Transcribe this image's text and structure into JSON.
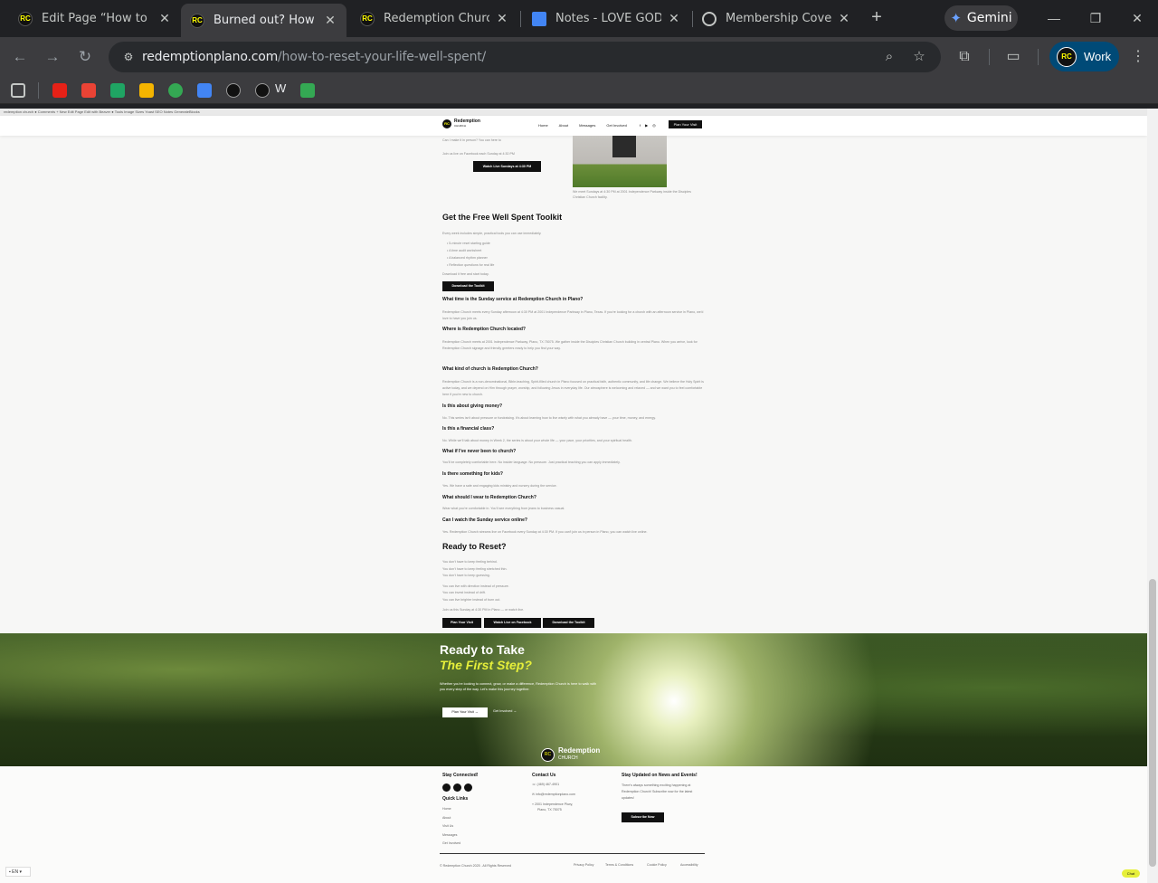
{
  "browser": {
    "tabs": [
      {
        "title": "Edit Page “How to Res"
      },
      {
        "title": "Burned out? How to R"
      },
      {
        "title": "Redemption Church | I"
      },
      {
        "title": "Notes - LOVE GOD Sta"
      },
      {
        "title": "Membership Covenan"
      }
    ],
    "gemini_label": "Gemini",
    "url_host": "redemptionplano.com",
    "url_path": "/how-to-reset-your-life-well-spent/",
    "profile_label": "Work",
    "bookmark_w": "W"
  },
  "site": {
    "admin_bar": "redemption church   ● Comments   + New   Edit Page   Edit with Beaver   ● Tools   Image Sizes   Yoast SEO   Notes   GenerateBlocks",
    "header": {
      "logo_name": "Redemption",
      "logo_sub": "CHURCH",
      "menu": [
        "Home",
        "About",
        "Messages",
        "Get Involved"
      ],
      "plan_button": "Plan Your Visit"
    },
    "top": {
      "line1": "Can I make it in person? You can here to",
      "line2": "Join us live on Facebook each Sunday at 4:30 PM",
      "watch_button": "Watch Live Sundays at 4:30 PM",
      "photo_caption": "We meet Sundays at 4:30 PM at 2001 Independence Parkway inside the Disciples Christian Church facility."
    },
    "toolkit": {
      "title": "Get the Free Well Spent Toolkit",
      "intro": "Every week includes simple, practical tools you can use immediately.",
      "items": [
        "5-minute reset starting guide",
        "A time audit worksheet",
        "A balanced rhythm planner",
        "Reflection questions for real life"
      ],
      "outro": "Download it free and start today.",
      "button": "Download the Toolkit"
    },
    "faq": [
      {
        "q": "What time is the Sunday service at Redemption Church in Plano?",
        "a": "Redemption Church meets every Sunday afternoon at 4:30 PM at 2001 Independence Parkway in Plano, Texas. If you're looking for a church with an afternoon service in Plano, we'd love to have you join us."
      },
      {
        "q": "Where is Redemption Church located?",
        "a": "Redemption Church meets at 2001 Independence Parkway, Plano, TX 75075. We gather inside the Disciples Christian Church building in central Plano. When you arrive, look for Redemption Church signage and friendly greeters ready to help you find your way."
      },
      {
        "q": "What kind of church is Redemption Church?",
        "a": "Redemption Church is a non-denominational, Bible-teaching, Spirit-filled church in Plano focused on practical faith, authentic community, and life change. We believe the Holy Spirit is active today, and we depend on Him through prayer, worship, and following Jesus in everyday life. Our atmosphere is welcoming and relaxed — and we want you to feel comfortable here if you're new to church."
      },
      {
        "q": "Is this about giving money?",
        "a": "No. This series isn't about pressure or fundraising. It's about learning how to live wisely with what you already have — your time, money, and energy."
      },
      {
        "q": "Is this a financial class?",
        "a": "No. While we'll talk about money in Week 2, the series is about your whole life — your pace, your priorities, and your spiritual health."
      },
      {
        "q": "What if I've never been to church?",
        "a": "You'll be completely comfortable here. No insider language. No pressure. Just practical teaching you can apply immediately."
      },
      {
        "q": "Is there something for kids?",
        "a": "Yes. We have a safe and engaging kids ministry and nursery during the service."
      },
      {
        "q": "What should I wear to Redemption Church?",
        "a": "Wear what you're comfortable in. You'll see everything from jeans to business casual."
      },
      {
        "q": "Can I watch the Sunday service online?",
        "a": "Yes. Redemption Church streams live on Facebook every Sunday at 4:30 PM. If you can't join us in person in Plano, you can watch live online."
      }
    ],
    "reset": {
      "title": "Ready to Reset?",
      "lines_a": [
        "You don't have to keep feeling behind.",
        "You don't have to keep feeling stretched thin.",
        "You don't have to keep guessing."
      ],
      "lines_b": [
        "You can live with direction instead of pressure.",
        "You can invest instead of drift.",
        "You can live brighter instead of burn out."
      ],
      "closing": "Join us this Sunday at 4:30 PM in Plano — or watch live.",
      "buttons": [
        "Plan Your Visit",
        "Watch Live on Facebook",
        "Download the Toolkit"
      ]
    },
    "hero": {
      "title_1": "Ready to Take",
      "title_2": "The First Step?",
      "text": "Whether you're looking to connect, grow, or make a difference, Redemption Church is here to walk with you every step of the way. Let's make this journey together.",
      "btn_primary": "Plan Your Visit",
      "btn_secondary": "Get Involved",
      "logo_name": "Redemption",
      "logo_sub": "CHURCH"
    },
    "footer": {
      "connected": "Stay Connected!",
      "quick_links_title": "Quick Links",
      "quick_links": [
        "Home",
        "About",
        "Visit Us",
        "Messages",
        "Get Involved"
      ],
      "contact_title": "Contact Us",
      "phone": "(469) 467-4901",
      "email": "info@redemptionplano.com",
      "address_1": "2001 Independence Pkwy,",
      "address_2": "Plano, TX 75075",
      "news_title": "Stay Updated on News and Events!",
      "news_text": "There's always something exciting happening at Redemption Church! Subscribe now for the latest updates!",
      "subscribe": "Subscribe Now",
      "copyright": "© Redemption Church 2025 . All Rights Reserved",
      "legal": [
        "Privacy Policy",
        "Terms & Conditions",
        "Cookie Policy",
        "Accessibility"
      ]
    },
    "lang_label": "EN",
    "chat_label": "Chat"
  }
}
